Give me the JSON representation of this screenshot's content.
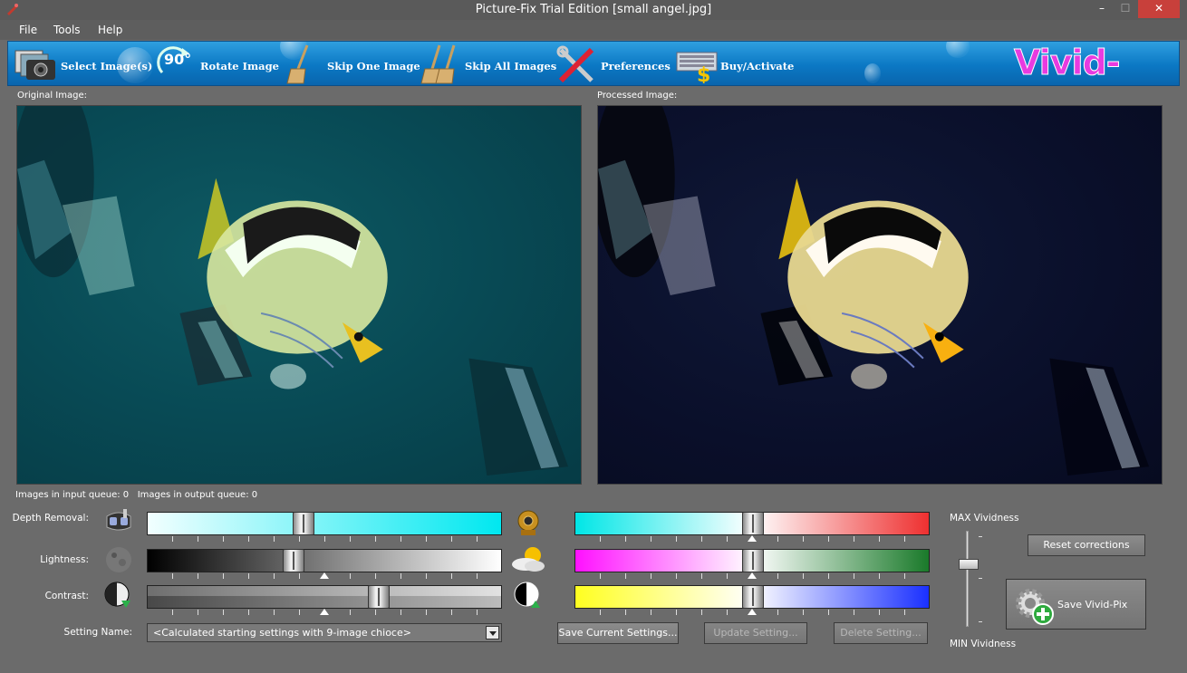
{
  "window": {
    "title": "Picture-Fix Trial Edition  [small angel.jpg]",
    "minimize": "–",
    "maximize": "☐",
    "close": "✕"
  },
  "menu": [
    "File",
    "Tools",
    "Help"
  ],
  "toolbar": {
    "select_images": "Select Image(s)",
    "rotate_icon_text": "90°",
    "rotate_image": "Rotate Image",
    "skip_one": "Skip One Image",
    "skip_all": "Skip All Images",
    "preferences": "Preferences",
    "buy_activate": "Buy/Activate",
    "logo": "Vivid-Pix",
    "logo_mark": "®"
  },
  "panels": {
    "original_label": "Original Image:",
    "processed_label": "Processed Image:"
  },
  "queue": {
    "input_label": "Images in input queue:",
    "input_count": "0",
    "output_label": "Images in output queue:",
    "output_count": "0"
  },
  "sliders": {
    "depth_label": "Depth Removal:",
    "lightness_label": "Lightness:",
    "contrast_label": "Contrast:",
    "depth_value": 0.44,
    "lightness_value": 0.41,
    "lightness_marker": 0.5,
    "contrast_value": 0.65,
    "contrast_marker": 0.5,
    "cyan_red_value": 0.5,
    "magenta_green_value": 0.5,
    "yellow_blue_value": 0.5
  },
  "settings": {
    "label": "Setting Name:",
    "selected": "<Calculated starting settings with 9-image chioce>",
    "save_current": "Save Current Settings...",
    "update": "Update Setting...",
    "delete": "Delete Setting..."
  },
  "vividness": {
    "max_label": "MAX Vividness",
    "min_label": "MIN Vividness",
    "level": 0.35
  },
  "actions": {
    "reset": "Reset corrections",
    "save_vivid": "Save Vivid-Pix"
  },
  "colors": {
    "cyan": "#00e6e6",
    "red": "#ee3030",
    "magenta": "#ff10ff",
    "green": "#1a7a2a",
    "yellow": "#ffff20",
    "blue": "#1a30ff"
  }
}
